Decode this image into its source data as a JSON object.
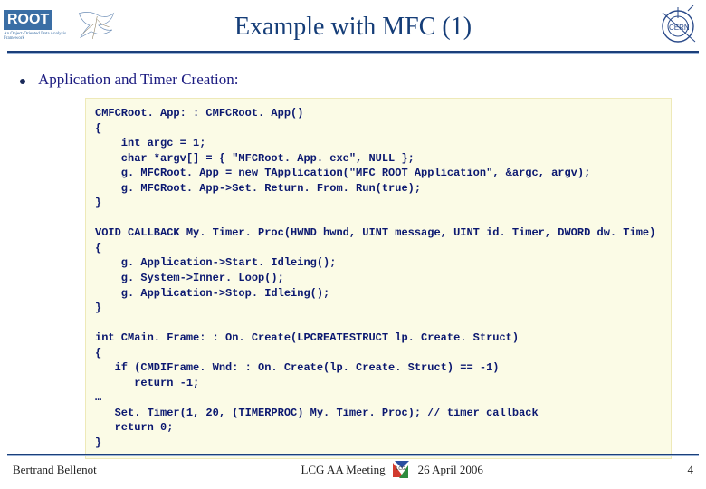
{
  "header": {
    "logo_text": "ROOT",
    "logo_tagline": "An Object-Oriented Data Analysis Framework",
    "title": "Example with MFC (1)",
    "right_logo_label": "CERN"
  },
  "content": {
    "bullet": "Application and Timer Creation:",
    "code": "CMFCRoot. App: : CMFCRoot. App()\n{\n    int argc = 1;\n    char *argv[] = { \"MFCRoot. App. exe\", NULL };\n    g. MFCRoot. App = new TApplication(\"MFC ROOT Application\", &argc, argv);\n    g. MFCRoot. App->Set. Return. From. Run(true);\n}\n\nVOID CALLBACK My. Timer. Proc(HWND hwnd, UINT message, UINT id. Timer, DWORD dw. Time)\n{\n    g. Application->Start. Idleing();\n    g. System->Inner. Loop();\n    g. Application->Stop. Idleing();\n}\n\nint CMain. Frame: : On. Create(LPCREATESTRUCT lp. Create. Struct)\n{\n   if (CMDIFrame. Wnd: : On. Create(lp. Create. Struct) == -1)\n      return -1;\n…\n   Set. Timer(1, 20, (TIMERPROC) My. Timer. Proc); // timer callback\n   return 0;\n}"
  },
  "footer": {
    "author": "Bertrand Bellenot",
    "event": "LCG AA Meeting",
    "lcg_label": "LCG",
    "date": "26 April 2006",
    "page": "4"
  }
}
